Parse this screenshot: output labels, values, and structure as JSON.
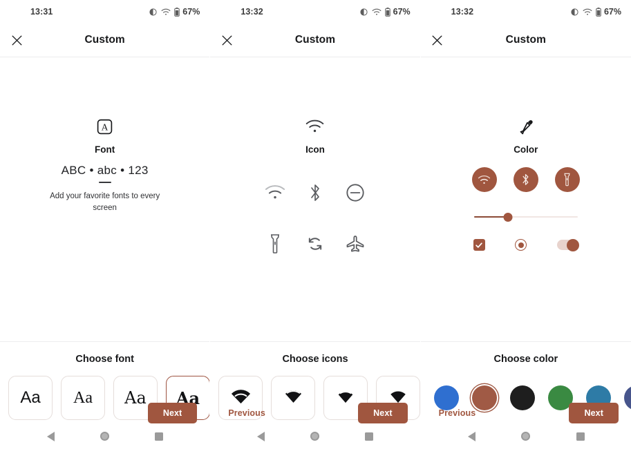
{
  "theme": {
    "accent": "#a0563f",
    "accent_light": "#b5715c",
    "track": "#f1e6e3",
    "card_border": "#e5ddda",
    "divider": "#ededee",
    "text": "#17181a"
  },
  "screens": [
    {
      "id": "font-screen",
      "statusbar": {
        "time": "13:31",
        "battery": "67%"
      },
      "appbar": {
        "title": "Custom",
        "close_icon": "close-icon"
      },
      "preview": {
        "kind": "font",
        "hero_icon": "font-a-box-icon",
        "hero_label": "Font",
        "sample": "ABC • abc • 123",
        "description": "Add your favorite fonts to every screen"
      },
      "chooser": {
        "title": "Choose font",
        "cards": [
          {
            "label": "Aa",
            "style": "sans",
            "selected": false
          },
          {
            "label": "Aa",
            "style": "serif",
            "selected": false
          },
          {
            "label": "Aa",
            "style": "serif-alt",
            "selected": false
          },
          {
            "label": "Aa",
            "style": "serif-bold",
            "selected": true
          }
        ]
      },
      "actions": {
        "previous": "",
        "next": "Next",
        "show_previous": false
      },
      "navbar": {
        "back": "back-icon",
        "home": "home-icon",
        "recents": "recents-icon"
      }
    },
    {
      "id": "icon-screen",
      "statusbar": {
        "time": "13:32",
        "battery": "67%"
      },
      "appbar": {
        "title": "Custom",
        "close_icon": "close-icon"
      },
      "preview": {
        "kind": "icon",
        "hero_icon": "wifi-icon",
        "hero_label": "Icon",
        "grid": [
          "wifi-icon",
          "bluetooth-icon",
          "do-not-disturb-icon",
          "flashlight-icon",
          "auto-rotate-icon",
          "airplane-mode-icon"
        ]
      },
      "chooser": {
        "title": "Choose icons",
        "cards": [
          {
            "label": "wifi-filled-icon",
            "style": "icon",
            "selected": false
          },
          {
            "label": "wifi-filled-icon",
            "style": "icon",
            "selected": false
          },
          {
            "label": "wifi-filled-icon",
            "style": "icon",
            "selected": false
          },
          {
            "label": "wifi-filled-icon",
            "style": "icon",
            "selected": false
          }
        ]
      },
      "actions": {
        "previous": "Previous",
        "next": "Next",
        "show_previous": true
      },
      "navbar": {
        "back": "back-icon",
        "home": "home-icon",
        "recents": "recents-icon"
      }
    },
    {
      "id": "color-screen",
      "statusbar": {
        "time": "13:32",
        "battery": "67%"
      },
      "appbar": {
        "title": "Custom",
        "close_icon": "close-icon"
      },
      "preview": {
        "kind": "color",
        "hero_icon": "eyedropper-icon",
        "hero_label": "Color",
        "chips": [
          "wifi-icon",
          "bluetooth-icon",
          "flashlight-icon"
        ],
        "slider": {
          "value_percent": 33
        },
        "controls": {
          "checkbox_checked": true,
          "radio_selected": true,
          "switch_on": true
        }
      },
      "chooser": {
        "title": "Choose color",
        "swatches": [
          {
            "name": "blue",
            "hex": "#2f6fd0",
            "selected": false
          },
          {
            "name": "brown",
            "hex": "#a05a45",
            "selected": true
          },
          {
            "name": "black",
            "hex": "#1e1e1e",
            "selected": false
          },
          {
            "name": "green",
            "hex": "#3a8a42",
            "selected": false
          },
          {
            "name": "teal-blue",
            "hex": "#2e7ba6",
            "selected": false
          },
          {
            "name": "slate-blue",
            "hex": "#47558c",
            "selected": false
          }
        ]
      },
      "actions": {
        "previous": "Previous",
        "next": "Next",
        "show_previous": true
      },
      "navbar": {
        "back": "back-icon",
        "home": "home-icon",
        "recents": "recents-icon"
      }
    }
  ]
}
